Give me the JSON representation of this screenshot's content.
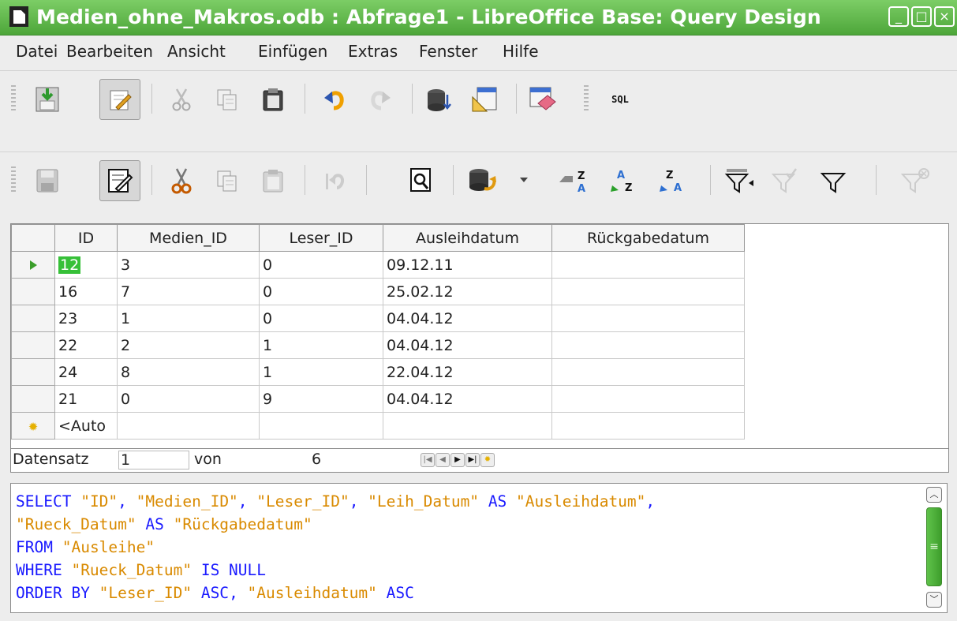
{
  "window": {
    "title": "Medien_ohne_Makros.odb : Abfrage1 - LibreOffice Base: Query Design",
    "min_label": "_",
    "max_label": "□",
    "close_label": "×"
  },
  "menu": [
    "Datei",
    "Bearbeiten",
    "Ansicht",
    "Einfügen",
    "Extras",
    "Fenster",
    "Hilfe"
  ],
  "toolbar1": {
    "icons": [
      "save-icon",
      "edit-icon",
      "cut-icon",
      "copy-icon",
      "paste-icon",
      "undo-icon",
      "redo-icon",
      "add-table-icon",
      "design-view-icon",
      "clear-query-icon",
      "sql-icon"
    ],
    "sql_label": "SQL"
  },
  "toolbar2": {
    "icons": [
      "save-record-icon",
      "edit-data-icon",
      "cut-icon",
      "copy-icon",
      "paste-icon",
      "undo-icon",
      "find-record-icon",
      "refresh-icon",
      "sort-icon",
      "sort-ascending-icon",
      "sort-descending-icon",
      "autofilter-icon",
      "apply-filter-icon",
      "standard-filter-icon",
      "reset-filter-icon"
    ]
  },
  "grid": {
    "columns": [
      "ID",
      "Medien_ID",
      "Leser_ID",
      "Ausleihdatum",
      "Rückgabedatum"
    ],
    "rows": [
      [
        "12",
        "3",
        "0",
        "09.12.11",
        ""
      ],
      [
        "16",
        "7",
        "0",
        "25.02.12",
        ""
      ],
      [
        "23",
        "1",
        "0",
        "04.04.12",
        ""
      ],
      [
        "22",
        "2",
        "1",
        "04.04.12",
        ""
      ],
      [
        "24",
        "8",
        "1",
        "22.04.12",
        ""
      ],
      [
        "21",
        "0",
        "9",
        "04.04.12",
        ""
      ]
    ],
    "new_row_placeholder": "<Auto"
  },
  "navigation": {
    "record_label": "Datensatz",
    "current": "1",
    "of_label": "von",
    "total": "6"
  },
  "sql_lines": [
    "SELECT \"ID\", \"Medien_ID\", \"Leser_ID\", \"Leih_Datum\" AS \"Ausleihdatum\",",
    "\"Rueck_Datum\" AS \"Rückgabedatum\"",
    "FROM \"Ausleihe\"",
    "WHERE \"Rueck_Datum\" IS NULL",
    "ORDER BY \"Leser_ID\" ASC, \"Ausleihdatum\" ASC"
  ],
  "colors": {
    "titlebar": "#5aaf45",
    "keyword": "#1a1aff",
    "string": "#d98a00",
    "selection": "#36c038"
  }
}
